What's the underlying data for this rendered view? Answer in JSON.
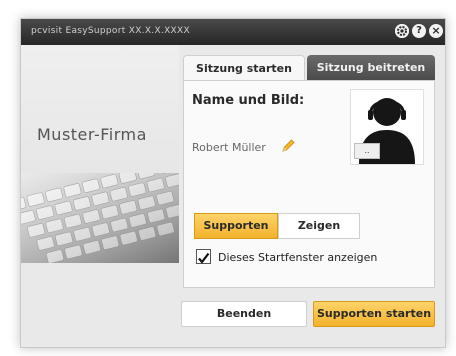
{
  "window": {
    "title": "pcvisit EasySupport XX.X.X.XXXX",
    "icons": [
      "settings-icon",
      "help-icon",
      "close-icon"
    ]
  },
  "branding": {
    "company_name": "Muster-Firma"
  },
  "tabs": [
    {
      "label": "Sitzung starten",
      "active": true
    },
    {
      "label": "Sitzung beitreten",
      "active": false
    }
  ],
  "session_start": {
    "heading": "Name und Bild:",
    "user_name": "Robert Müller",
    "avatar_browse_label": "..",
    "mode_options": [
      {
        "label": "Supporten",
        "selected": true
      },
      {
        "label": "Zeigen",
        "selected": false
      }
    ],
    "show_start_window": {
      "label": "Dieses Startfenster anzeigen",
      "checked": true
    }
  },
  "footer": {
    "quit_label": "Beenden",
    "primary_label": "Supporten starten"
  },
  "colors": {
    "accent": "#f3b22b",
    "titlebar": "#2e2e2e"
  }
}
